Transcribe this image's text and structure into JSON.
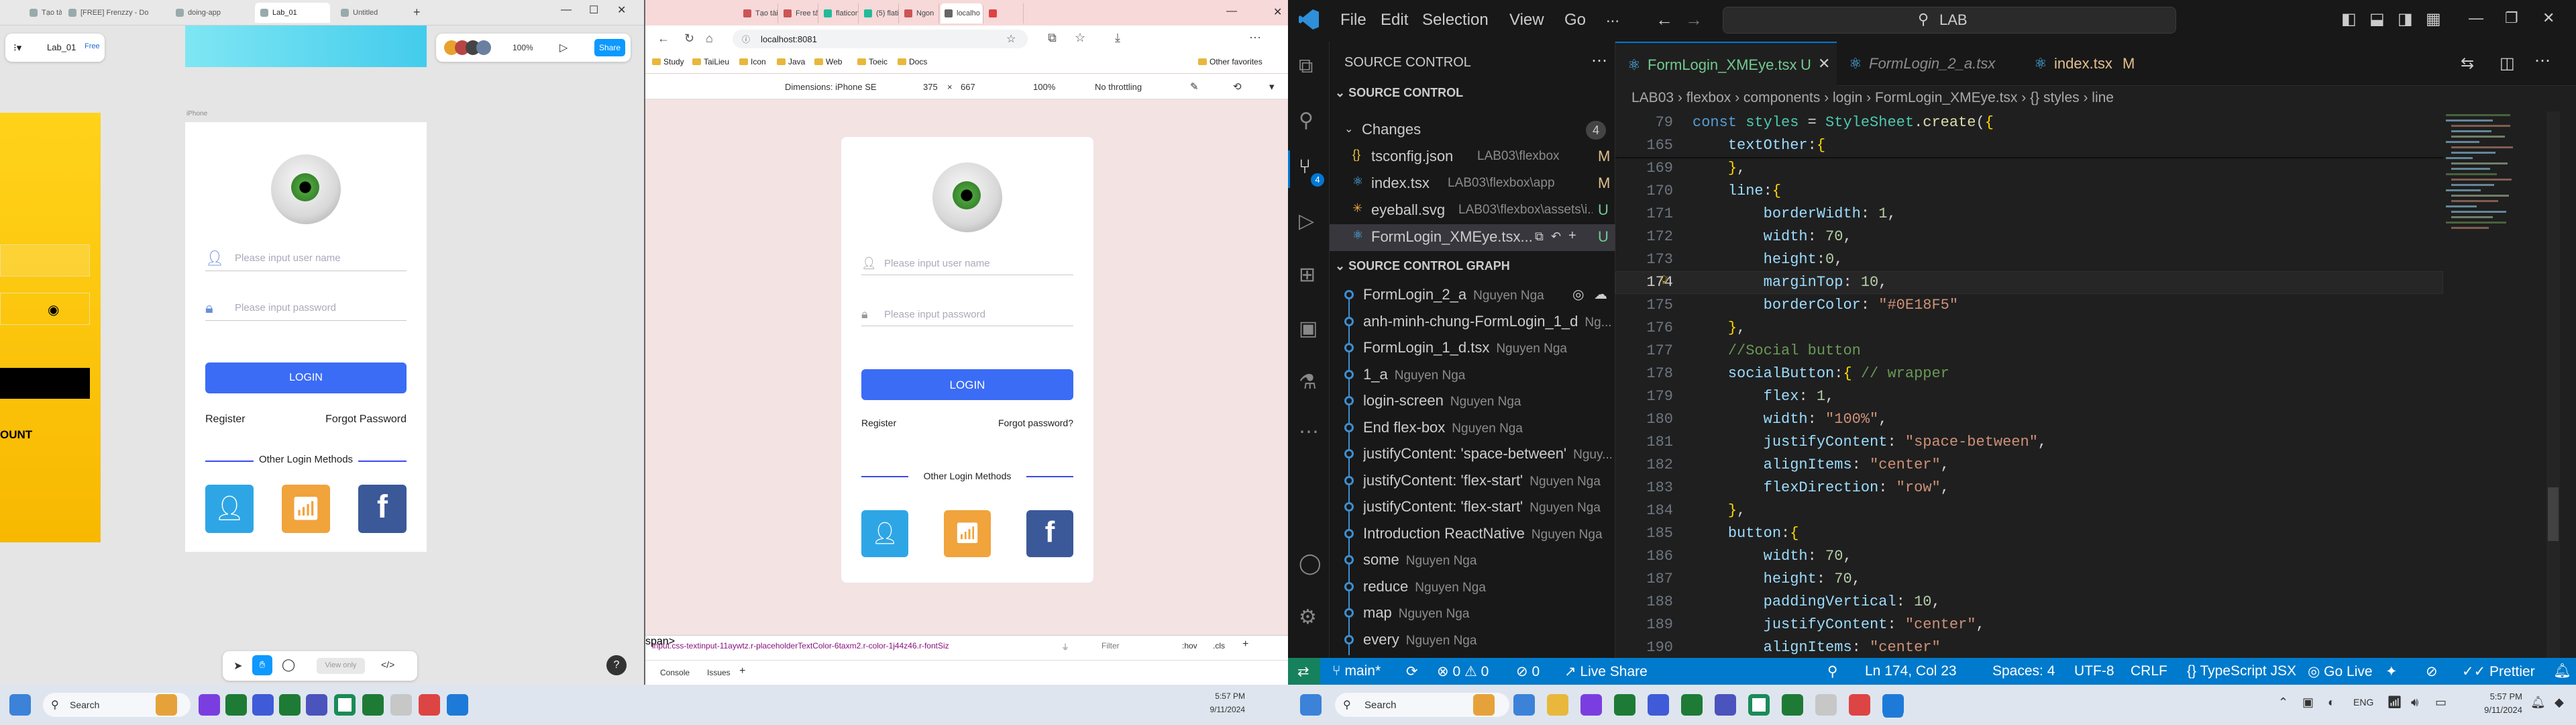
{
  "figma_window": {
    "tabs": [
      {
        "label": "Tạo tài"
      },
      {
        "label": "[FREE] Frenzzy - Do"
      },
      {
        "label": "doing-app"
      },
      {
        "label": "Lab_01"
      },
      {
        "label": "Untitled"
      }
    ],
    "file_name": "Lab_01",
    "plan_badge": "Free",
    "zoom": "100%",
    "share_label": "Share",
    "frame_label": "iPhone",
    "left_frame": {
      "account_label": "OUNT"
    },
    "design": {
      "username_placeholder": "Please input user name",
      "password_placeholder": "Please input password",
      "login_label": "LOGIN",
      "register_label": "Register",
      "forgot_label": "Forgot Password",
      "other_label": "Other Login Methods"
    },
    "bottom_toolbar": {
      "view_only": "View only"
    },
    "help": "?"
  },
  "browser_window": {
    "tabs": [
      {
        "label": "Tạo tài"
      },
      {
        "label": "Free tả"
      },
      {
        "label": "flaticon"
      },
      {
        "label": "(5) flaticon"
      },
      {
        "label": "Ngon"
      },
      {
        "label": "localho"
      },
      {
        "label": ""
      }
    ],
    "url": "localhost:8081",
    "bookmarks": [
      "Study",
      "TaiLieu",
      "Icon",
      "Java",
      "Web",
      "Toeic",
      "Docs"
    ],
    "other_bookmarks": "Other favorites",
    "devtools": {
      "dimensions_label": "Dimensions: iPhone SE",
      "width": "375",
      "times": "×",
      "height": "667",
      "zoom": "100%",
      "throttle": "No throttling",
      "element_path": "input.css-textinput-11aywtz.r-placeholderTextColor-6taxm2.r-color-1j44z46.r-fontSiz",
      "filter": "Filter",
      "hov": ":hov",
      "cls": ".cls",
      "console_tab": "Console",
      "issues_tab": "Issues"
    },
    "app": {
      "username_placeholder": "Please input user name",
      "password_placeholder": "Please input password",
      "login_label": "LOGIN",
      "register_label": "Register",
      "forgot_label": "Forgot password?",
      "other_label": "Other Login Methods"
    }
  },
  "vscode": {
    "menu": [
      "File",
      "Edit",
      "Selection",
      "View",
      "Go",
      "..."
    ],
    "search_text": "LAB",
    "sidebar": {
      "title": "SOURCE CONTROL",
      "section": "SOURCE CONTROL",
      "changes_label": "Changes",
      "changes_count": "4",
      "files": [
        {
          "name": "tsconfig.json",
          "path": "LAB03\\flexbox",
          "status": "M"
        },
        {
          "name": "index.tsx",
          "path": "LAB03\\flexbox\\app",
          "status": "M"
        },
        {
          "name": "eyeball.svg",
          "path": "LAB03\\flexbox\\assets\\i...",
          "status": "U"
        },
        {
          "name": "FormLogin_XMEye.tsx...",
          "path": "",
          "status": "U"
        }
      ],
      "graph_title": "SOURCE CONTROL GRAPH",
      "commits": [
        {
          "msg": "FormLogin_2_a",
          "author": "Nguyen Nga"
        },
        {
          "msg": "anh-minh-chung-FormLogin_1_d",
          "author": "Ng..."
        },
        {
          "msg": "FormLogin_1_d.tsx",
          "author": "Nguyen Nga"
        },
        {
          "msg": "1_a",
          "author": "Nguyen Nga"
        },
        {
          "msg": "login-screen",
          "author": "Nguyen Nga"
        },
        {
          "msg": "End flex-box",
          "author": "Nguyen Nga"
        },
        {
          "msg": "justifyContent: 'space-between'",
          "author": "Nguy..."
        },
        {
          "msg": " justifyContent: 'flex-start'",
          "author": "Nguyen Nga"
        },
        {
          "msg": " justifyContent: 'flex-start'",
          "author": "Nguyen Nga"
        },
        {
          "msg": "Introduction ReactNative",
          "author": "Nguyen Nga"
        },
        {
          "msg": "some",
          "author": "Nguyen Nga"
        },
        {
          "msg": "reduce",
          "author": "Nguyen Nga"
        },
        {
          "msg": "map",
          "author": "Nguyen Nga"
        },
        {
          "msg": "every",
          "author": "Nguyen Nga"
        }
      ]
    },
    "tabs": [
      {
        "label": "FormLogin_XMEye.tsx",
        "badge": "U"
      },
      {
        "label": "FormLogin_2_a.tsx",
        "badge": ""
      },
      {
        "label": "index.tsx",
        "badge": "M"
      }
    ],
    "breadcrumb": "LAB03 › flexbox › components › login › FormLogin_XMEye.tsx › {} styles › line",
    "lines": [
      {
        "n": "79",
        "html": "<span class='kw'>const</span> <span class='t'>styles</span> = <span class='t'>StyleSheet</span>.<span class='f'>create</span>(<span class='b'>{</span>"
      },
      {
        "n": "165",
        "html": "    <span class='k'>textOther</span>:<span class='b'>{</span>"
      },
      {
        "n": "169",
        "html": "    <span class='b'>}</span>,"
      },
      {
        "n": "170",
        "html": "    <span class='k'>line</span>:<span class='b'>{</span>"
      },
      {
        "n": "171",
        "html": "        <span class='k'>borderWidth</span>: <span class='n'>1</span>,"
      },
      {
        "n": "172",
        "html": "        <span class='k'>width</span>: <span class='n'>70</span>,"
      },
      {
        "n": "173",
        "html": "        <span class='k'>height</span>:<span class='n'>0</span>,"
      },
      {
        "n": "174",
        "html": "        <span class='k'>marginTop</span>: <span class='n'>10</span>,"
      },
      {
        "n": "175",
        "html": "        <span class='k'>borderColor</span>: <span class='s'>\"#0E18F5\"</span>"
      },
      {
        "n": "176",
        "html": "    <span class='b'>}</span>,"
      },
      {
        "n": "177",
        "html": "    <span class='c'>//Social button</span>"
      },
      {
        "n": "178",
        "html": "    <span class='k'>socialButton</span>:<span class='b'>{</span> <span class='c'>// wrapper</span>"
      },
      {
        "n": "179",
        "html": "        <span class='k'>flex</span>: <span class='n'>1</span>,"
      },
      {
        "n": "180",
        "html": "        <span class='k'>width</span>: <span class='s'>\"100%\"</span>,"
      },
      {
        "n": "181",
        "html": "        <span class='k'>justifyContent</span>: <span class='s'>\"space-between\"</span>,"
      },
      {
        "n": "182",
        "html": "        <span class='k'>alignItems</span>: <span class='s'>\"center\"</span>,"
      },
      {
        "n": "183",
        "html": "        <span class='k'>flexDirection</span>: <span class='s'>\"row\"</span>,"
      },
      {
        "n": "184",
        "html": "    <span class='b'>}</span>,"
      },
      {
        "n": "185",
        "html": "    <span class='k'>button</span>:<span class='b'>{</span>"
      },
      {
        "n": "186",
        "html": "        <span class='k'>width</span>: <span class='n'>70</span>,"
      },
      {
        "n": "187",
        "html": "        <span class='k'>height</span>: <span class='n'>70</span>,"
      },
      {
        "n": "188",
        "html": "        <span class='k'>paddingVertical</span>: <span class='n'>10</span>,"
      },
      {
        "n": "189",
        "html": "        <span class='k'>justifyContent</span>: <span class='s'>\"center\"</span>,"
      },
      {
        "n": "190",
        "html": "        <span class='k'>alignItems</span>: <span class='s'>\"center\"</span>"
      }
    ],
    "status": {
      "branch": "main*",
      "errors": "0",
      "warnings": "0",
      "ports": "0",
      "live_share": "Live Share",
      "position": "Ln 174, Col 23",
      "spaces": "Spaces: 4",
      "encoding": "UTF-8",
      "eol": "CRLF",
      "language": "TypeScript JSX",
      "go_live": "Go Live",
      "prettier": "Prettier"
    }
  },
  "taskbar": {
    "left_search": "Search",
    "right_search": "Search",
    "left_time": "5:57 PM",
    "left_date": "9/11/2024",
    "lang": "ENG",
    "time": "5:57 PM",
    "date": "9/11/2024"
  },
  "colors": {
    "accent_blue": "#3b6cf6",
    "facebook_blue": "#3b5998",
    "wifi_orange": "#f1a33c",
    "add_user_blue": "#2ea6e5",
    "vscode_status": "#007acc"
  }
}
